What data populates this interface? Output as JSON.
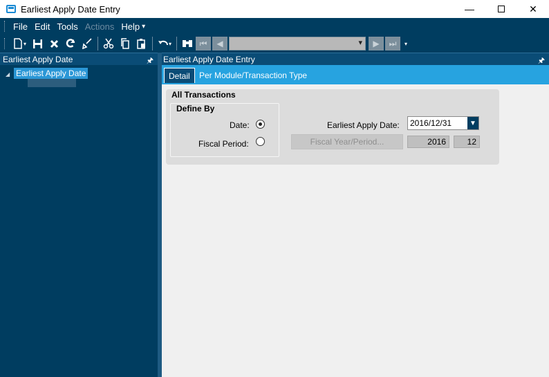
{
  "window": {
    "title": "Earliest Apply Date Entry",
    "minimize_glyph": "—",
    "close_glyph": "✕"
  },
  "menu": {
    "items": [
      {
        "label": "File",
        "disabled": false
      },
      {
        "label": "Edit",
        "disabled": false
      },
      {
        "label": "Tools",
        "disabled": false
      },
      {
        "label": "Actions",
        "disabled": true
      },
      {
        "label": "Help",
        "disabled": false
      }
    ]
  },
  "toolbar": {
    "icons": [
      "new-icon",
      "save-icon",
      "delete-icon",
      "refresh-icon",
      "clear-icon",
      "cut-icon",
      "copy-icon",
      "paste-icon",
      "undo-icon",
      "find-icon",
      "first-record-icon",
      "previous-record-icon",
      "next-record-icon",
      "last-record-icon"
    ]
  },
  "left_panel": {
    "title": "Earliest Apply Date",
    "tree_root": "Earliest Apply Date"
  },
  "right_panel": {
    "title": "Earliest Apply Date Entry",
    "tabs": [
      {
        "label": "Detail",
        "active": true
      },
      {
        "label": "Per Module/Transaction Type",
        "active": false
      }
    ],
    "group_title": "All Transactions",
    "define_by": {
      "title": "Define By",
      "date_label": "Date:",
      "date_selected": true,
      "fiscal_period_label": "Fiscal Period:",
      "fiscal_period_selected": false
    },
    "earliest_apply_date_label": "Earliest Apply Date:",
    "earliest_apply_date_value": "2016/12/31",
    "fiscal_button_label": "Fiscal Year/Period...",
    "fiscal_year": "2016",
    "fiscal_period": "12"
  },
  "colors": {
    "chrome": "#003d60",
    "accent": "#27a3e0",
    "selection": "#2b97d6"
  }
}
